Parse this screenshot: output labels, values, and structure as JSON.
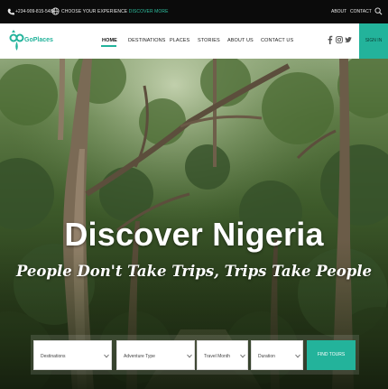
{
  "topbar": {
    "phone": "+234-909-815-5488",
    "promo_text": "CHOOSE YOUR EXPERIENCE",
    "promo_link": "DISCOVER MORE",
    "about": "ABOUT",
    "separator": "·",
    "contact": "CONTACT",
    "icons": [
      "phone-icon",
      "globe-icon",
      "search-icon"
    ]
  },
  "brand": {
    "name": "GoPlaces",
    "accent_color": "#23b39b"
  },
  "nav": {
    "items": [
      {
        "label": "HOME",
        "active": true
      },
      {
        "label": "DESTINATIONS",
        "active": false
      },
      {
        "label": "PLACES",
        "active": false
      },
      {
        "label": "STORIES",
        "active": false
      },
      {
        "label": "ABOUT US",
        "active": false
      },
      {
        "label": "CONTACT US",
        "active": false
      }
    ],
    "social_icons": [
      "facebook-icon",
      "instagram-icon",
      "twitter-icon"
    ],
    "signin": "SIGN IN"
  },
  "hero": {
    "title": "Discover Nigeria",
    "subtitle": "People Don't Take Trips, Trips Take People"
  },
  "search": {
    "fields": [
      {
        "label": "Destinations"
      },
      {
        "label": "Adventure Type"
      },
      {
        "label": "Travel Month"
      },
      {
        "label": "Duration"
      }
    ],
    "button": "FIND TOURS"
  }
}
